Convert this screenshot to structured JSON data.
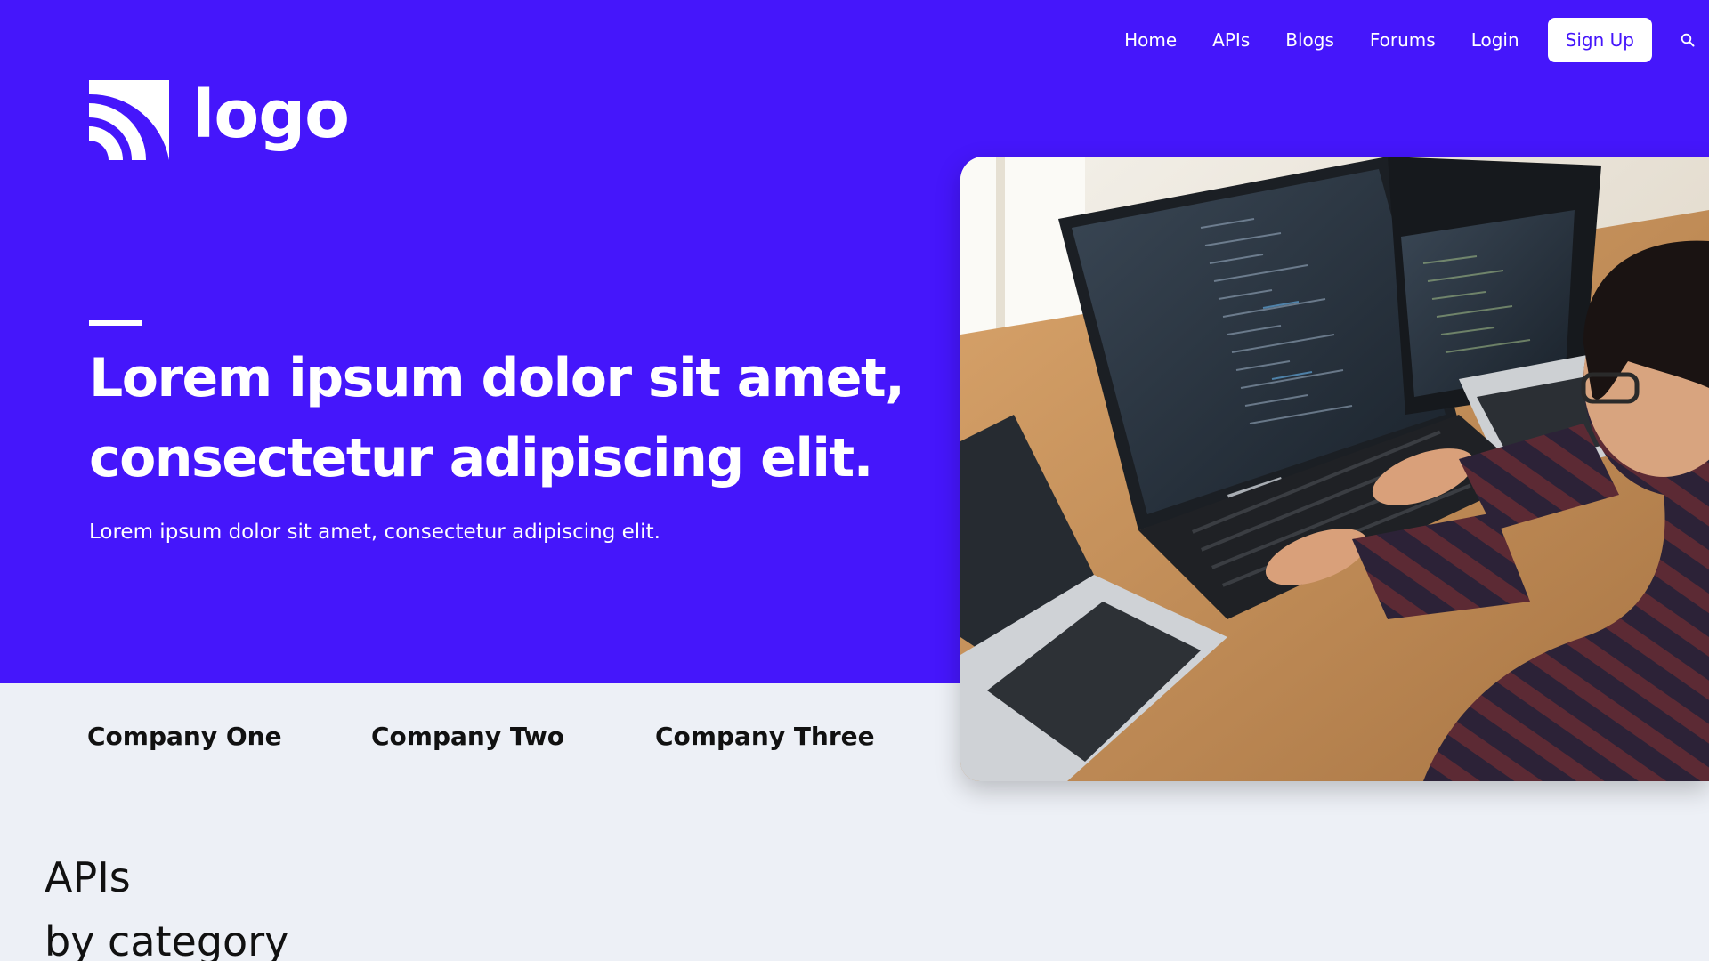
{
  "logo": {
    "text": "logo",
    "icon": "wave-logo-icon"
  },
  "nav": {
    "items": [
      {
        "label": "Home"
      },
      {
        "label": "APIs"
      },
      {
        "label": "Blogs"
      },
      {
        "label": "Forums"
      },
      {
        "label": "Login"
      }
    ],
    "signup_label": "Sign Up",
    "search_icon": "search-icon"
  },
  "hero": {
    "title_line1": "Lorem ipsum dolor sit amet,",
    "title_line2": "consectetur adipiscing elit.",
    "subtitle": "Lorem ipsum dolor sit amet, consectetur adipiscing elit.",
    "image_subject": "developer-at-desk-photo"
  },
  "companies": [
    "Company One",
    "Company Two",
    "Company Three"
  ],
  "section": {
    "title_line1": "APIs",
    "title_line2": "by category"
  },
  "colors": {
    "brand": "#4516fb",
    "page_background": "#edf0f6",
    "text_dark": "#111111",
    "text_light": "#ffffff"
  }
}
